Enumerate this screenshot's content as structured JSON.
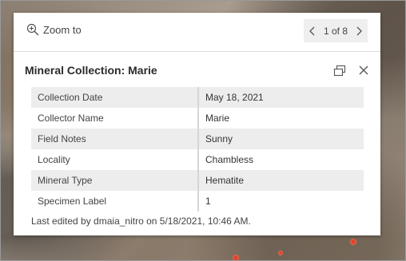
{
  "map": {
    "background": "satellite-imagery",
    "marker_color": "#e0452a"
  },
  "popup": {
    "zoom_to_label": "Zoom to",
    "pager": {
      "current": "1",
      "of_label": "of",
      "total": "8",
      "text": "1 of 8"
    },
    "title": "Mineral Collection: Marie",
    "attributes": [
      {
        "key": "Collection Date",
        "value": "May 18, 2021"
      },
      {
        "key": "Collector Name",
        "value": "Marie"
      },
      {
        "key": "Field Notes",
        "value": "Sunny"
      },
      {
        "key": "Locality",
        "value": "Chambless"
      },
      {
        "key": "Mineral Type",
        "value": "Hematite"
      },
      {
        "key": "Specimen Label",
        "value": "1"
      }
    ],
    "last_edited": "Last edited by dmaia_nitro on 5/18/2021, 10:46 AM."
  }
}
